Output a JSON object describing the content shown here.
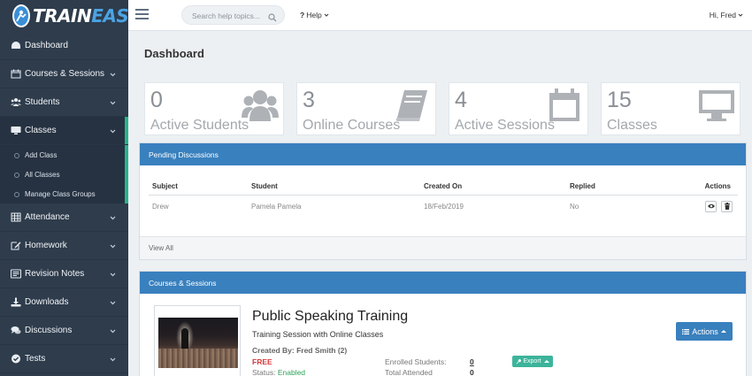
{
  "brand": {
    "train": "TRAIN",
    "easy": "EASY"
  },
  "sidebar": {
    "items": [
      {
        "label": "Dashboard",
        "icon": "dashboard-icon"
      },
      {
        "label": "Courses & Sessions",
        "icon": "calendar-icon"
      },
      {
        "label": "Students",
        "icon": "users-icon"
      },
      {
        "label": "Classes",
        "icon": "monitor-icon",
        "active": true
      },
      {
        "label": "Attendance",
        "icon": "table-icon"
      },
      {
        "label": "Homework",
        "icon": "edit-icon"
      },
      {
        "label": "Revision Notes",
        "icon": "notes-icon"
      },
      {
        "label": "Downloads",
        "icon": "download-icon"
      },
      {
        "label": "Discussions",
        "icon": "comments-icon"
      },
      {
        "label": "Tests",
        "icon": "check-circle-icon"
      }
    ],
    "sub_items": [
      "Add Class",
      "All Classes",
      "Manage Class Groups"
    ]
  },
  "topbar": {
    "search_placeholder": "Search help topics...",
    "help_label": "Help",
    "user_label": "Hi, Fred"
  },
  "page": {
    "title": "Dashboard"
  },
  "stats": [
    {
      "value": "0",
      "label": "Active Students",
      "icon": "users-icon"
    },
    {
      "value": "3",
      "label": "Online Courses",
      "icon": "book-icon"
    },
    {
      "value": "4",
      "label": "Active Sessions",
      "icon": "calendar-icon"
    },
    {
      "value": "15",
      "label": "Classes",
      "icon": "monitor-icon"
    }
  ],
  "discussions": {
    "title": "Pending Discussions",
    "columns": [
      "Subject",
      "Student",
      "Created On",
      "Replied",
      "Actions"
    ],
    "rows": [
      {
        "subject": "Drew",
        "student": "Pamela Pamela",
        "created_on": "18/Feb/2019",
        "replied": "No"
      }
    ],
    "footer": "View All"
  },
  "courses": {
    "title": "Courses & Sessions",
    "course": {
      "name": "Public Speaking Training",
      "subtitle": "Training Session with Online Classes",
      "created_by": "Created By: Fred Smith (2)",
      "price": "FREE",
      "status_label": "Status:",
      "status_value": "Enabled",
      "enrolled_label": "Enrolled Students:",
      "enrolled_value": "0",
      "attended_label": "Total Attended",
      "attended_value": "0",
      "export_label": "Export",
      "actions_label": "Actions"
    }
  },
  "colors": {
    "sidebar": "#2e3c4c",
    "accent_blue": "#3980be",
    "active_green": "#26b48b",
    "export_green": "#3cb49b",
    "free_red": "#d9383a"
  }
}
